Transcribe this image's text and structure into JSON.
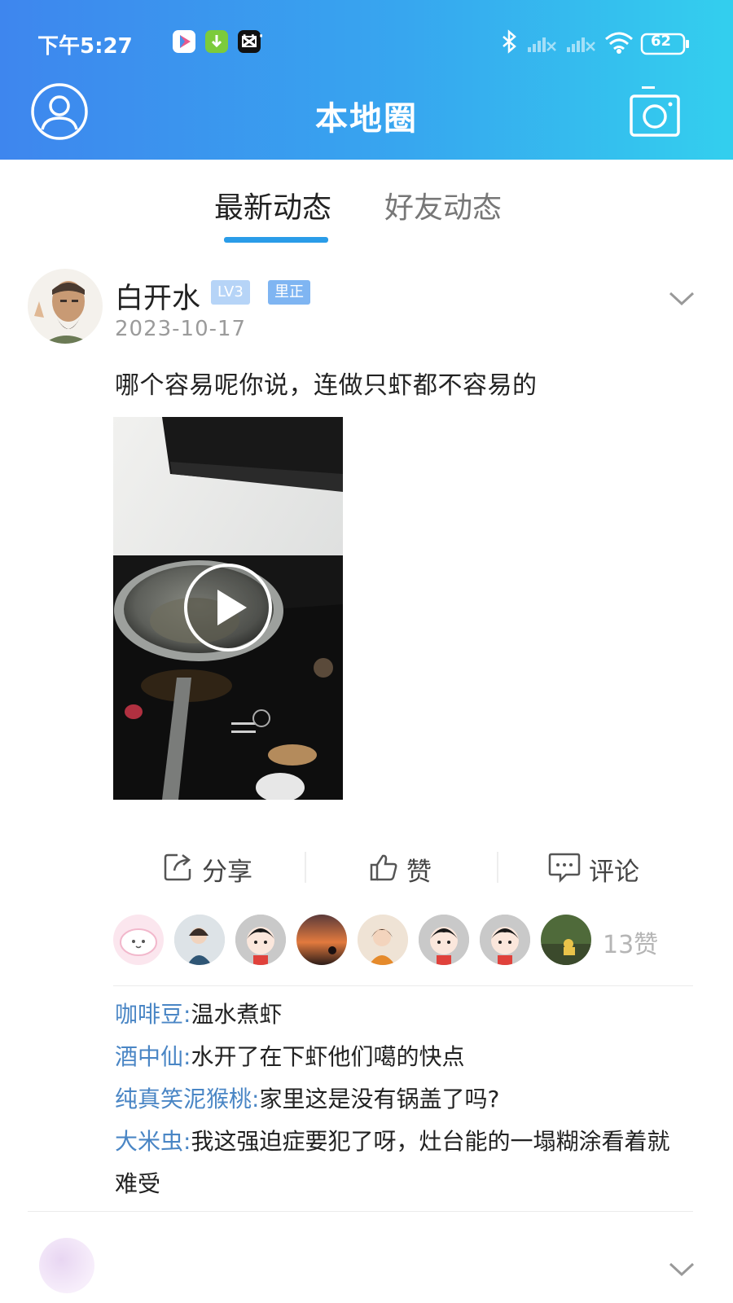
{
  "status_bar": {
    "time": "下午5:27",
    "battery": "62"
  },
  "header": {
    "title": "本地圈"
  },
  "tabs": [
    {
      "label": "最新动态",
      "active": true
    },
    {
      "label": "好友动态",
      "active": false
    }
  ],
  "post": {
    "username": "白开水",
    "level_badge": "LV3",
    "tag_badge": "里正",
    "date": "2023-10-17",
    "text": "哪个容易呢你说，连做只虾都不容易的",
    "media": "video"
  },
  "actions": {
    "share": "分享",
    "like": "赞",
    "comment": "评论"
  },
  "likes": {
    "count_label": "13赞"
  },
  "comments": [
    {
      "author": "咖啡豆:",
      "text": "温水煮虾"
    },
    {
      "author": "酒中仙:",
      "text": "水开了在下虾他们噶的快点"
    },
    {
      "author": "纯真笑泥猴桃:",
      "text": "家里这是没有锅盖了吗?"
    },
    {
      "author": "大米虫:",
      "text": "我这强迫症要犯了呀，灶台能的一塌糊涂看着就难受"
    }
  ],
  "colors": {
    "header_gradient_start": "#3e86ee",
    "header_gradient_end": "#33cfee",
    "tab_underline": "#2a9ce8",
    "comment_author": "#4a86c5"
  }
}
